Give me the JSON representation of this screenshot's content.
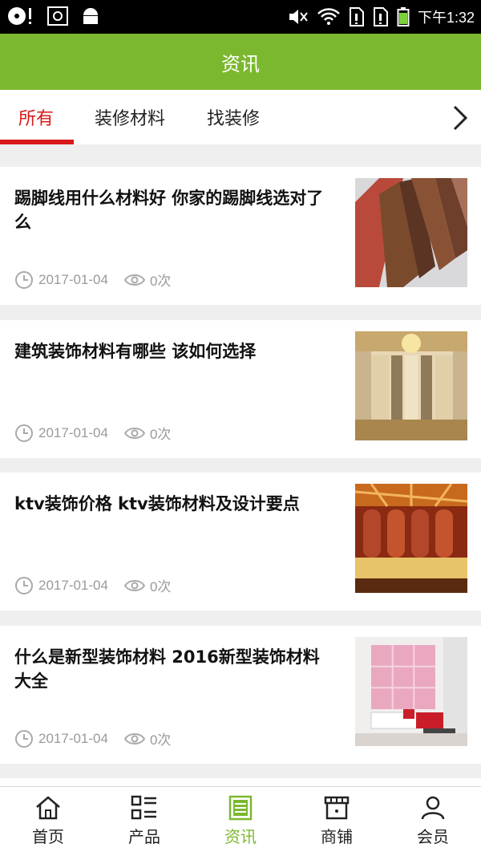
{
  "status_bar": {
    "time": "下午1:32"
  },
  "header": {
    "title": "资讯"
  },
  "tabs": [
    {
      "label": "所有",
      "active": true
    },
    {
      "label": "装修材料",
      "active": false
    },
    {
      "label": "找装修",
      "active": false
    }
  ],
  "articles": [
    {
      "title": "踢脚线用什么材料好 你家的踢脚线选对了么",
      "date": "2017-01-04",
      "views": "0次",
      "image": "skirting-board-photo"
    },
    {
      "title": "建筑装饰材料有哪些 该如何选择",
      "date": "2017-01-04",
      "views": "0次",
      "image": "interior-hall-photo"
    },
    {
      "title": "ktv装饰价格 ktv装饰材料及设计要点",
      "date": "2017-01-04",
      "views": "0次",
      "image": "ktv-room-photo"
    },
    {
      "title": "什么是新型装饰材料 2016新型装饰材料大全",
      "date": "2017-01-04",
      "views": "0次",
      "image": "living-room-photo"
    }
  ],
  "bottom_nav": [
    {
      "label": "首页",
      "icon": "home-icon",
      "active": false
    },
    {
      "label": "产品",
      "icon": "product-list-icon",
      "active": false
    },
    {
      "label": "资讯",
      "icon": "news-icon",
      "active": true
    },
    {
      "label": "商铺",
      "icon": "shop-icon",
      "active": false
    },
    {
      "label": "会员",
      "icon": "member-icon",
      "active": false
    }
  ],
  "colors": {
    "brand_green": "#7cb82f",
    "active_tab_red": "#d9191a",
    "meta_gray": "#9a9a9a"
  }
}
